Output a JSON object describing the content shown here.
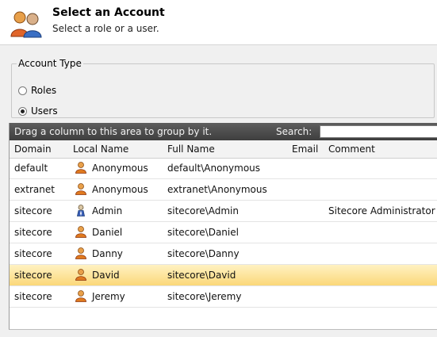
{
  "header": {
    "title": "Select an Account",
    "subtitle": "Select a role or a user.",
    "icon": "users-icon"
  },
  "account_type": {
    "legend": "Account Type",
    "options": [
      {
        "label": "Roles",
        "checked": false
      },
      {
        "label": "Users",
        "checked": true
      }
    ]
  },
  "grid": {
    "group_hint": "Drag a column to this area to group by it.",
    "search_label": "Search:",
    "search_value": "",
    "columns": [
      "Domain",
      "Local Name",
      "Full Name",
      "Email",
      "Comment"
    ],
    "rows": [
      {
        "domain": "default",
        "local": "Anonymous",
        "full": "default\\Anonymous",
        "email": "",
        "comment": "",
        "icon": "user-icon",
        "selected": false
      },
      {
        "domain": "extranet",
        "local": "Anonymous",
        "full": "extranet\\Anonymous",
        "email": "",
        "comment": "",
        "icon": "user-icon",
        "selected": false
      },
      {
        "domain": "sitecore",
        "local": "Admin",
        "full": "sitecore\\Admin",
        "email": "",
        "comment": "Sitecore Administrator",
        "icon": "admin-icon",
        "selected": false
      },
      {
        "domain": "sitecore",
        "local": "Daniel",
        "full": "sitecore\\Daniel",
        "email": "",
        "comment": "",
        "icon": "user-icon",
        "selected": false
      },
      {
        "domain": "sitecore",
        "local": "Danny",
        "full": "sitecore\\Danny",
        "email": "",
        "comment": "",
        "icon": "user-icon",
        "selected": false
      },
      {
        "domain": "sitecore",
        "local": "David",
        "full": "sitecore\\David",
        "email": "",
        "comment": "",
        "icon": "user-icon",
        "selected": true
      },
      {
        "domain": "sitecore",
        "local": "Jeremy",
        "full": "sitecore\\Jeremy",
        "email": "",
        "comment": "",
        "icon": "user-icon",
        "selected": false
      }
    ]
  },
  "colors": {
    "group_bar": "#4a4a4a",
    "selected_row": "#fbd879",
    "user_icon": "#e07a1f"
  }
}
